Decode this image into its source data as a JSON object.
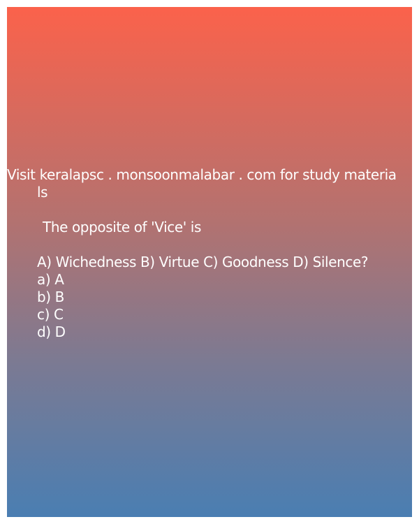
{
  "card": {
    "promo_line1": "Visit keralapsc . monsoonmalabar . com for study materia",
    "promo_line2": "ls",
    "question": "The opposite of 'Vice' is",
    "choices_line": "A) Wichedness B) Virtue C) Goodness D) Silence?",
    "options": [
      "a) A",
      "b) B",
      "c) C",
      "d) D"
    ]
  }
}
